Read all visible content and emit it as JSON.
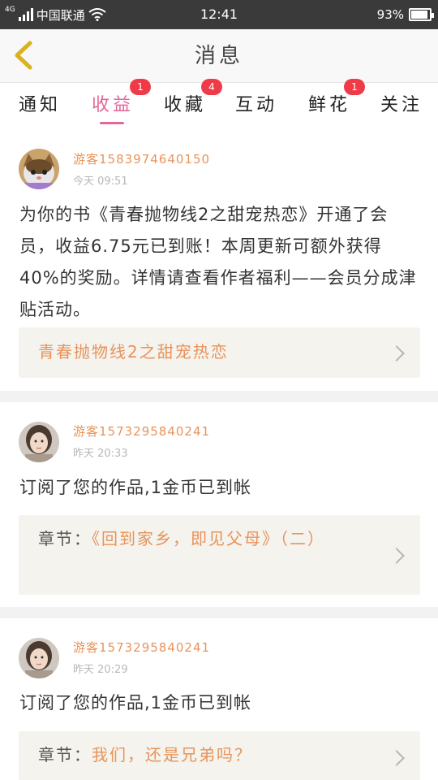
{
  "status_bar": {
    "network": "4G",
    "carrier": "中国联通",
    "time": "12:41",
    "battery_text": "93%",
    "battery_level": 0.93
  },
  "header": {
    "title": "消息",
    "back_icon": "chevron-left-icon"
  },
  "tabs": [
    {
      "label": "通知",
      "badge": ""
    },
    {
      "label": "收益",
      "badge": "1",
      "active": true
    },
    {
      "label": "收藏",
      "badge": "4"
    },
    {
      "label": "互动",
      "badge": ""
    },
    {
      "label": "鲜花",
      "badge": "1"
    },
    {
      "label": "关注",
      "badge": ""
    }
  ],
  "messages": [
    {
      "sender": "游客15839746401​50",
      "time": "今天 09:51",
      "body": "为你的书《青春抛物线2之甜宠热恋》开通了会员，收益6.75元已到账！本周更新可额外获得40%的奖励。详情请查看作者福利——会员分成津贴活动。",
      "card_prefix": "",
      "card_text": "青春抛物线2之甜宠热恋"
    },
    {
      "sender": "游客15732958402​41",
      "time": "昨天 20:33",
      "body": "订阅了您的作品,1金币已到帐",
      "card_prefix": "章节：",
      "card_text": "《回到家乡，即见父母》（二）"
    },
    {
      "sender": "游客15732958402​41",
      "time": "昨天 20:29",
      "body": "订阅了您的作品,1金币已到帐",
      "card_prefix": "章节：",
      "card_text": "我们，还是兄弟吗？"
    }
  ],
  "colors": {
    "accent": "#e2679a",
    "sender": "#e8935a",
    "badge": "#ef3b47",
    "card_bg": "#f4f3ee"
  }
}
